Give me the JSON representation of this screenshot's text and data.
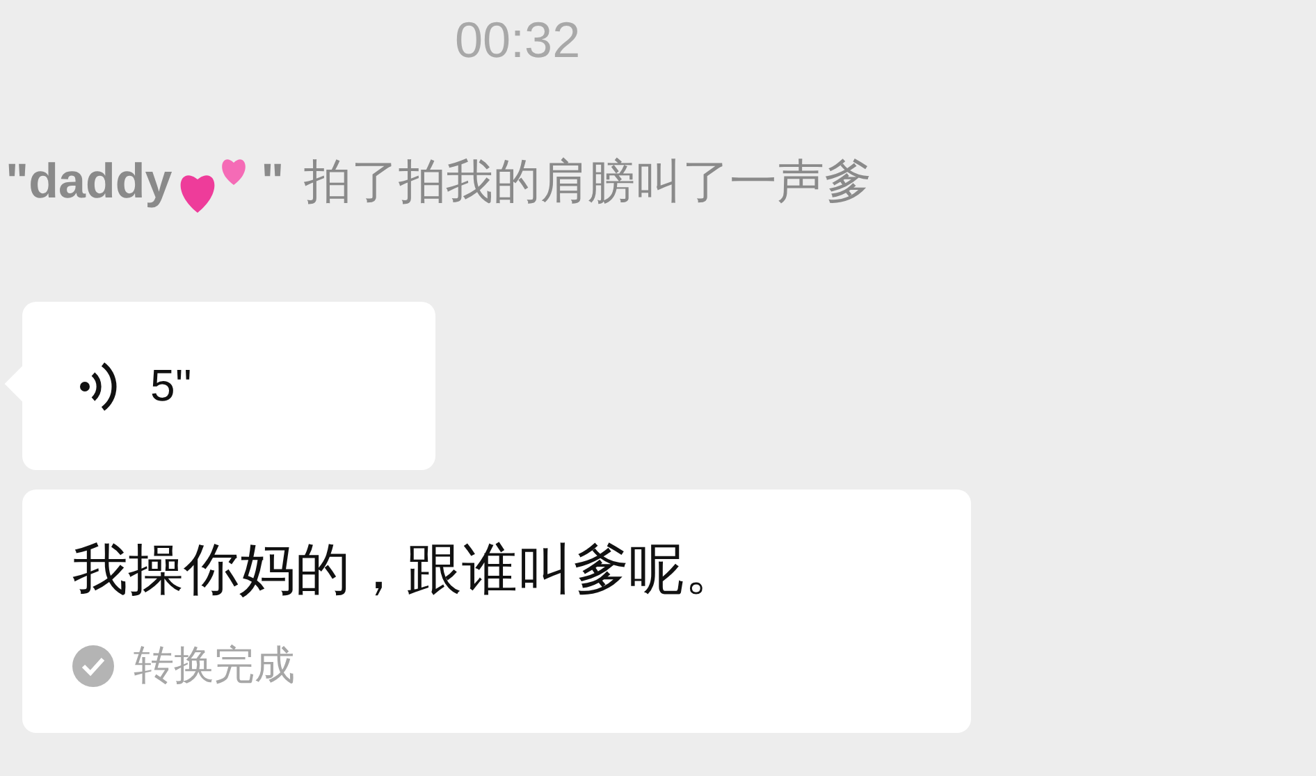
{
  "timestamp": "00:32",
  "pat_notice": {
    "name_open": "\"daddy",
    "name_close": "\"",
    "action": "拍了拍我的肩膀叫了一声爹"
  },
  "voice_message": {
    "duration": "5''"
  },
  "transcription": {
    "text": "我操你妈的，跟谁叫爹呢。",
    "status": "转换完成",
    "completed": true
  }
}
